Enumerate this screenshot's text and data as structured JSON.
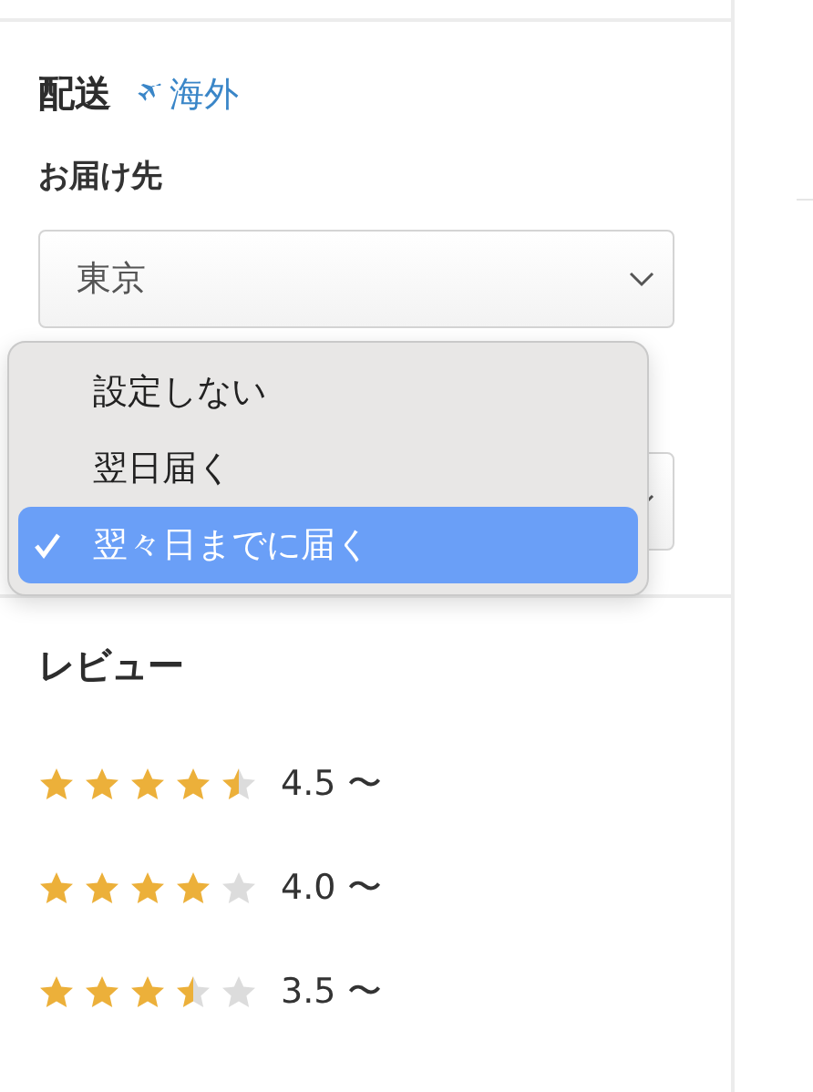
{
  "delivery": {
    "title": "配送",
    "overseas_link": "海外",
    "destination_label": "お届け先",
    "destination_value": "東京",
    "timing_menu": [
      {
        "label": "設定しない",
        "selected": false
      },
      {
        "label": "翌日届く",
        "selected": false
      },
      {
        "label": "翌々日までに届く",
        "selected": true
      }
    ]
  },
  "reviews": {
    "title": "レビュー",
    "filters": [
      {
        "stars": 4.5,
        "label": "4.5 〜"
      },
      {
        "stars": 4,
        "label": "4.0 〜"
      },
      {
        "stars": 3.5,
        "label": "3.5 〜"
      }
    ]
  }
}
